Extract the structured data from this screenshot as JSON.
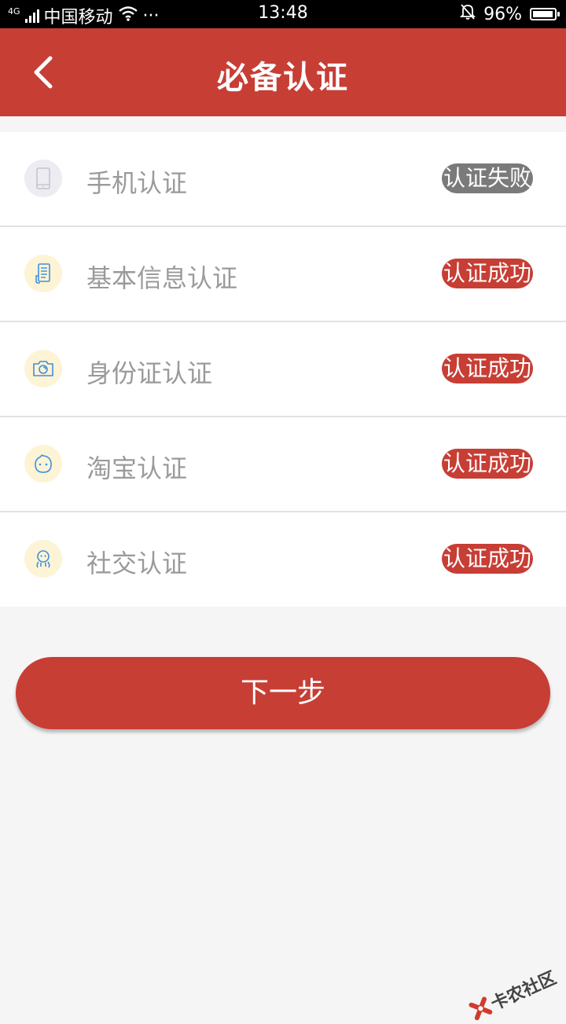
{
  "status_bar": {
    "network": "4G",
    "carrier": "中国移动",
    "more": "···",
    "time": "13:48",
    "battery": "96%",
    "battery_level": 0.96
  },
  "header": {
    "title": "必备认证",
    "back_icon": "chevron-left-icon"
  },
  "items": [
    {
      "label": "手机认证",
      "status": "认证失败",
      "icon": "phone-icon",
      "icon_bg": "#ececf2",
      "badge_color": "#7a7a7a"
    },
    {
      "label": "基本信息认证",
      "status": "认证成功",
      "icon": "document-icon",
      "icon_bg": "#fdf4d6",
      "badge_color": "#c73e35"
    },
    {
      "label": "身份证认证",
      "status": "认证成功",
      "icon": "camera-icon",
      "icon_bg": "#fdf4d6",
      "badge_color": "#c73e35"
    },
    {
      "label": "淘宝认证",
      "status": "认证成功",
      "icon": "taobao-icon",
      "icon_bg": "#fdf4d6",
      "badge_color": "#c73e35"
    },
    {
      "label": "社交认证",
      "status": "认证成功",
      "icon": "social-icon",
      "icon_bg": "#fdf4d6",
      "badge_color": "#c73e35"
    }
  ],
  "next_button": {
    "label": "下一步"
  },
  "watermark": {
    "text": "卡农社区"
  },
  "colors": {
    "primary": "#c73e35",
    "background": "#f5f5f5",
    "label": "#9a9a9a",
    "icon_blue": "#3f8fdf"
  }
}
